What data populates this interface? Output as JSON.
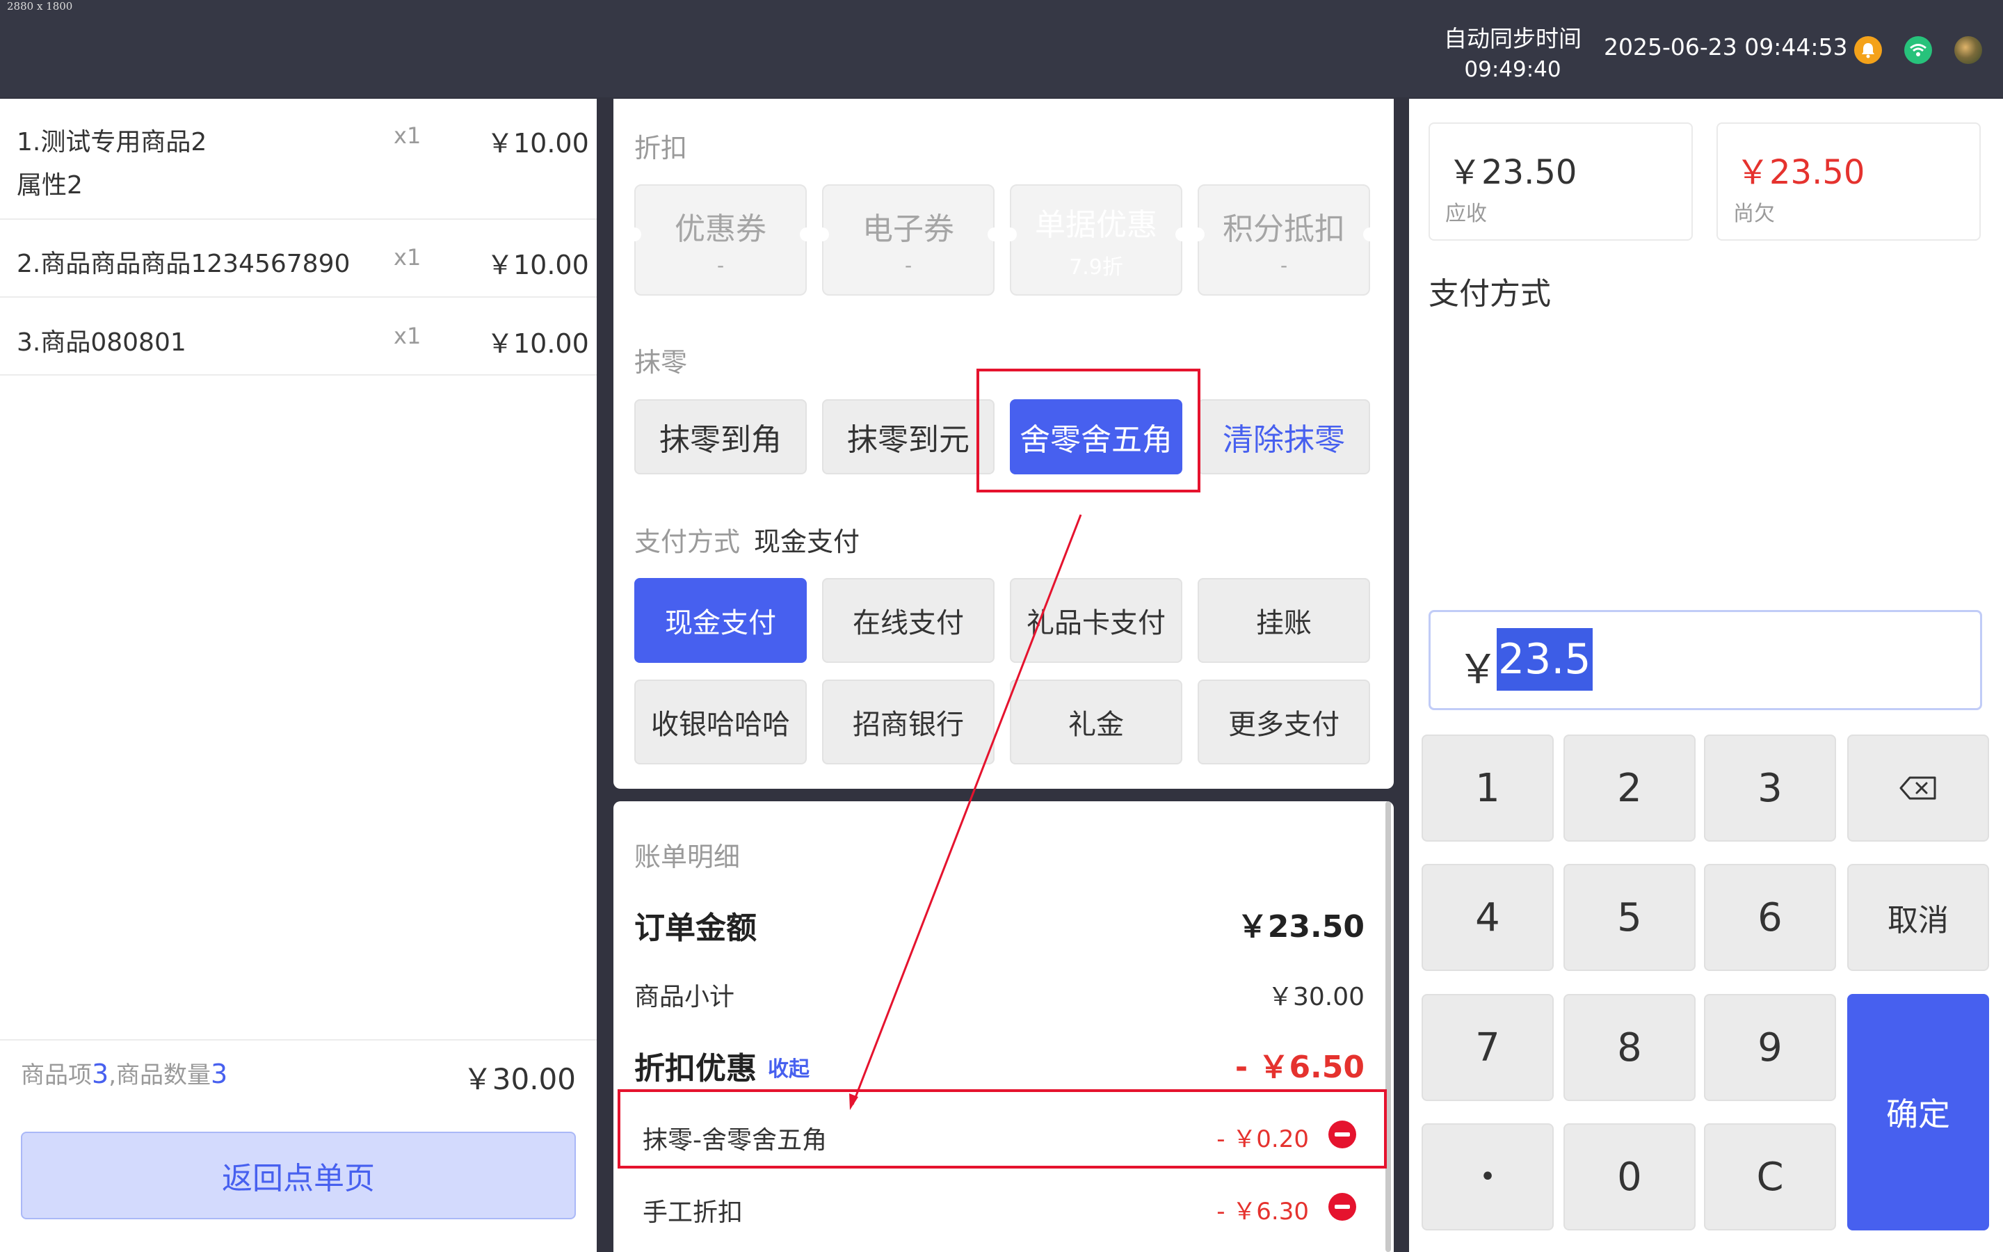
{
  "screen": {
    "dimension_label": "2880 x 1800"
  },
  "header": {
    "sync_label": "自动同步时间",
    "sync_time": "09:49:40",
    "datetime": "2025-06-23 09:44:53",
    "icons": [
      "bell-icon",
      "wifi-icon",
      "avatar"
    ]
  },
  "order_items": [
    {
      "name": "1.测试专用商品2",
      "attr": "属性2",
      "qty": "x1",
      "price": "￥10.00"
    },
    {
      "name": "2.商品商品商品1234567890",
      "qty": "x1",
      "price": "￥10.00"
    },
    {
      "name": "3.商品080801",
      "qty": "x1",
      "price": "￥10.00"
    }
  ],
  "summary": {
    "items_label": "商品项",
    "items_count": "3",
    "sep_label": ",商品数量",
    "qty_count": "3",
    "total": "￥30.00",
    "back_button": "返回点单页"
  },
  "discount": {
    "title": "折扣",
    "cards": [
      {
        "label": "优惠券",
        "value": "-"
      },
      {
        "label": "电子券",
        "value": "-"
      },
      {
        "label": "单据优惠",
        "value": "7.9折",
        "active": true
      },
      {
        "label": "积分抵扣",
        "value": "-"
      }
    ]
  },
  "rounding": {
    "title": "抹零",
    "buttons": [
      "抹零到角",
      "抹零到元",
      "舍零舍五角"
    ],
    "active": "舍零舍五角",
    "clear_label": "清除抹零"
  },
  "payment": {
    "title": "支付方式",
    "selected": "现金支付",
    "buttons": [
      "现金支付",
      "在线支付",
      "礼品卡支付",
      "挂账",
      "收银哈哈哈",
      "招商银行",
      "礼金",
      "更多支付"
    ],
    "active": "现金支付"
  },
  "bill": {
    "title": "账单明细",
    "order_amount_label": "订单金额",
    "order_amount": "￥23.50",
    "subtotal_label": "商品小计",
    "subtotal": "￥30.00",
    "discount_label": "折扣优惠",
    "collapse_label": "收起",
    "discount_total": "- ￥6.50",
    "lines": [
      {
        "label": "抹零-舍零舍五角",
        "amount": "- ￥0.20"
      },
      {
        "label": "手工折扣",
        "amount": "- ￥6.30"
      }
    ]
  },
  "right": {
    "receivable_amount": "￥23.50",
    "receivable_label": "应收",
    "owed_amount": "￥23.50",
    "owed_label": "尚欠",
    "payment_title": "支付方式",
    "currency": "￥",
    "input_value": "23.5"
  },
  "keypad": {
    "keys": [
      "1",
      "2",
      "3",
      "4",
      "5",
      "6",
      "7",
      "8",
      "9",
      "•",
      "0",
      "C"
    ],
    "cancel": "取消",
    "confirm": "确定",
    "backspace_icon": "backspace-icon"
  },
  "colors": {
    "accent": "#4760ef",
    "danger": "#e5322e",
    "annotation": "#e5132e",
    "topbar": "#363845"
  }
}
